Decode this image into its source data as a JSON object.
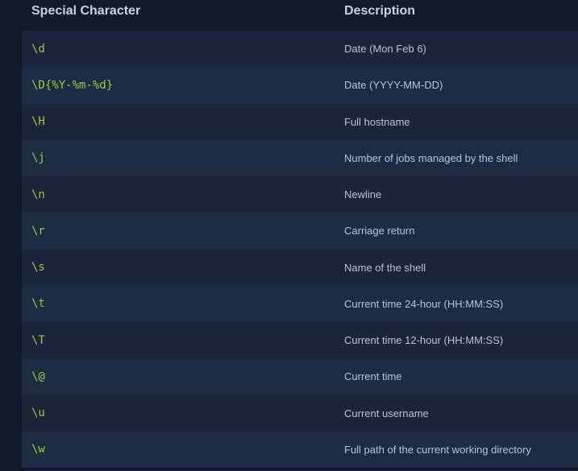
{
  "table": {
    "headers": {
      "special_character": "Special Character",
      "description": "Description"
    },
    "rows": [
      {
        "code": "\\d",
        "description": "Date (Mon Feb 6)"
      },
      {
        "code": "\\D{%Y-%m-%d}",
        "description": "Date (YYYY-MM-DD)"
      },
      {
        "code": "\\H",
        "description": "Full hostname"
      },
      {
        "code": "\\j",
        "description": "Number of jobs managed by the shell"
      },
      {
        "code": "\\n",
        "description": "Newline"
      },
      {
        "code": "\\r",
        "description": "Carriage return"
      },
      {
        "code": "\\s",
        "description": "Name of the shell"
      },
      {
        "code": "\\t",
        "description": "Current time 24-hour (HH:MM:SS)"
      },
      {
        "code": "\\T",
        "description": "Current time 12-hour (HH:MM:SS)"
      },
      {
        "code": "\\@",
        "description": "Current time"
      },
      {
        "code": "\\u",
        "description": "Current username"
      },
      {
        "code": "\\w",
        "description": "Full path of the current working directory"
      }
    ]
  },
  "colors": {
    "background": "#0f1a2b",
    "row_odd": "#18253a",
    "row_even": "#1e2c43",
    "code_text": "#9ccc3d",
    "header_text": "#c4d2ea",
    "description_text": "#b7c3d7"
  }
}
